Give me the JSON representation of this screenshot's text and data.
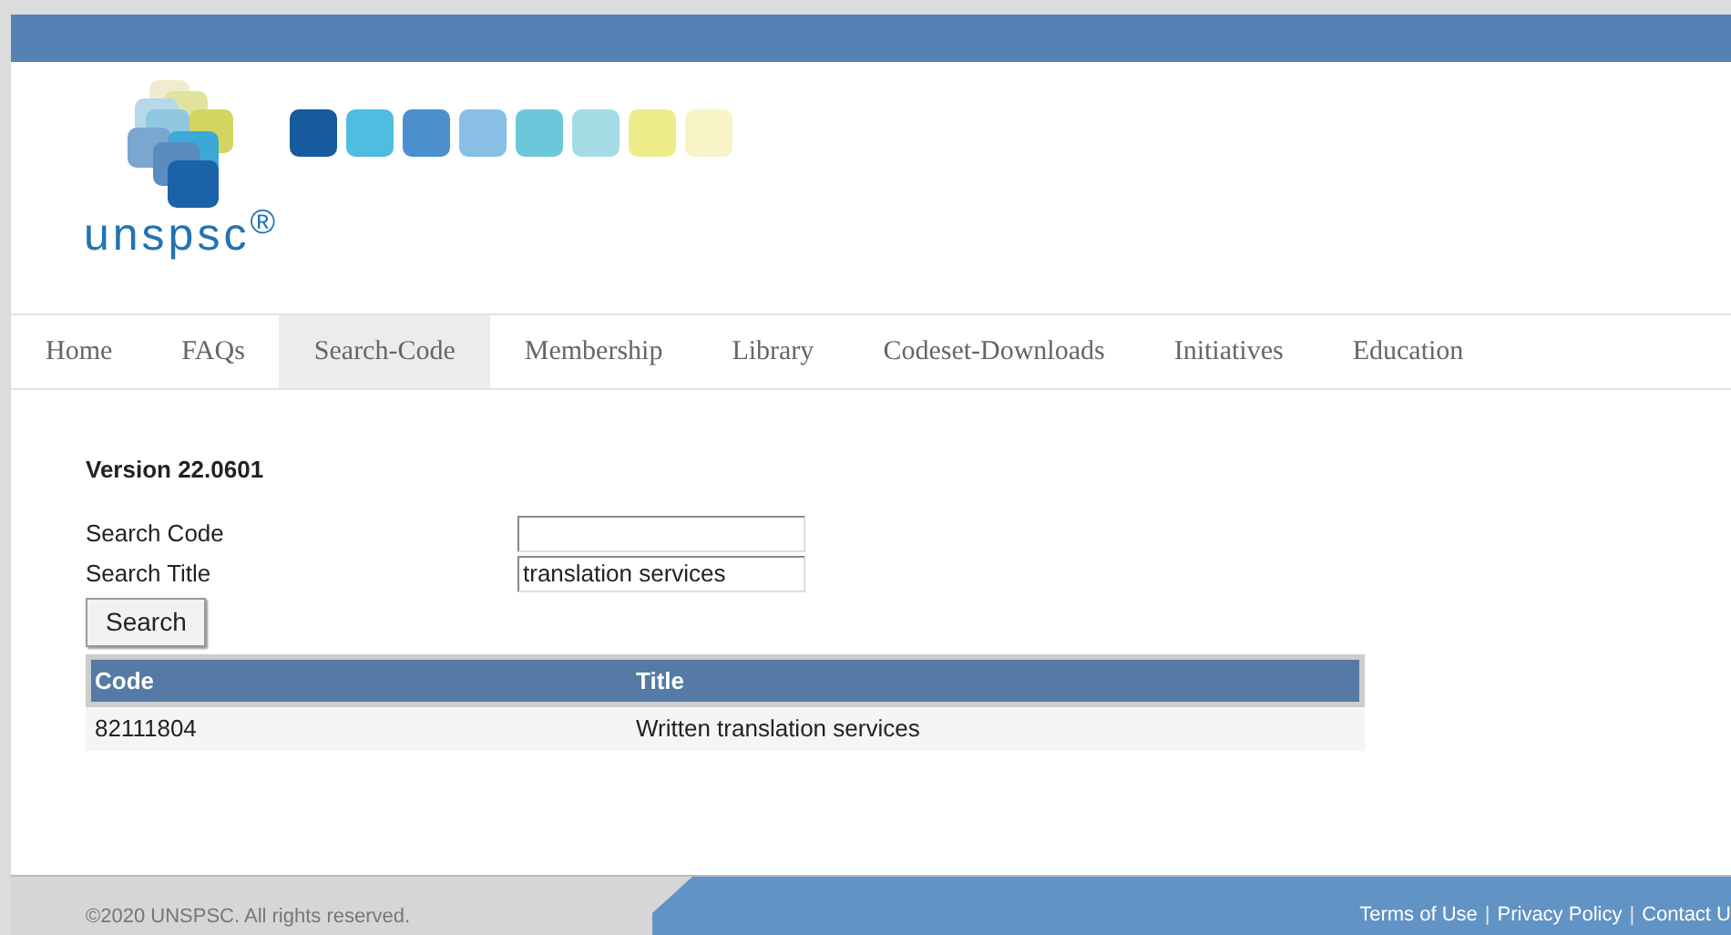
{
  "logo": {
    "text": "unspsc$^{®}$"
  },
  "nav": [
    {
      "label": "Home",
      "selected": false
    },
    {
      "label": "FAQs",
      "selected": false
    },
    {
      "label": "Search-Code",
      "selected": true
    },
    {
      "label": "Membership",
      "selected": false
    },
    {
      "label": "Library",
      "selected": false
    },
    {
      "label": "Codeset-Downloads",
      "selected": false
    },
    {
      "label": "Initiatives",
      "selected": false
    },
    {
      "label": "Education",
      "selected": false
    }
  ],
  "version": "Version 22.0601",
  "form": {
    "fields": [
      {
        "label": "Search Code"
      },
      {
        "label": "Search Title",
        "value": "translation services"
      }
    ],
    "button": "Search"
  },
  "table": {
    "columns": [
      "Code",
      "Title"
    ],
    "rows": [
      [
        "82111804",
        "Written translation services"
      ]
    ]
  },
  "footer": {
    "copyright": "©2020 UNSPSC. All rights reserved.",
    "links": [
      {
        "kind": "link",
        "text": "Terms of Use"
      },
      {
        "kind": "separator",
        "text": "|"
      },
      {
        "kind": "link",
        "text": "Privacy Policy"
      },
      {
        "kind": "separator",
        "text": "|"
      },
      {
        "kind": "link",
        "text": "Contact U"
      }
    ]
  }
}
